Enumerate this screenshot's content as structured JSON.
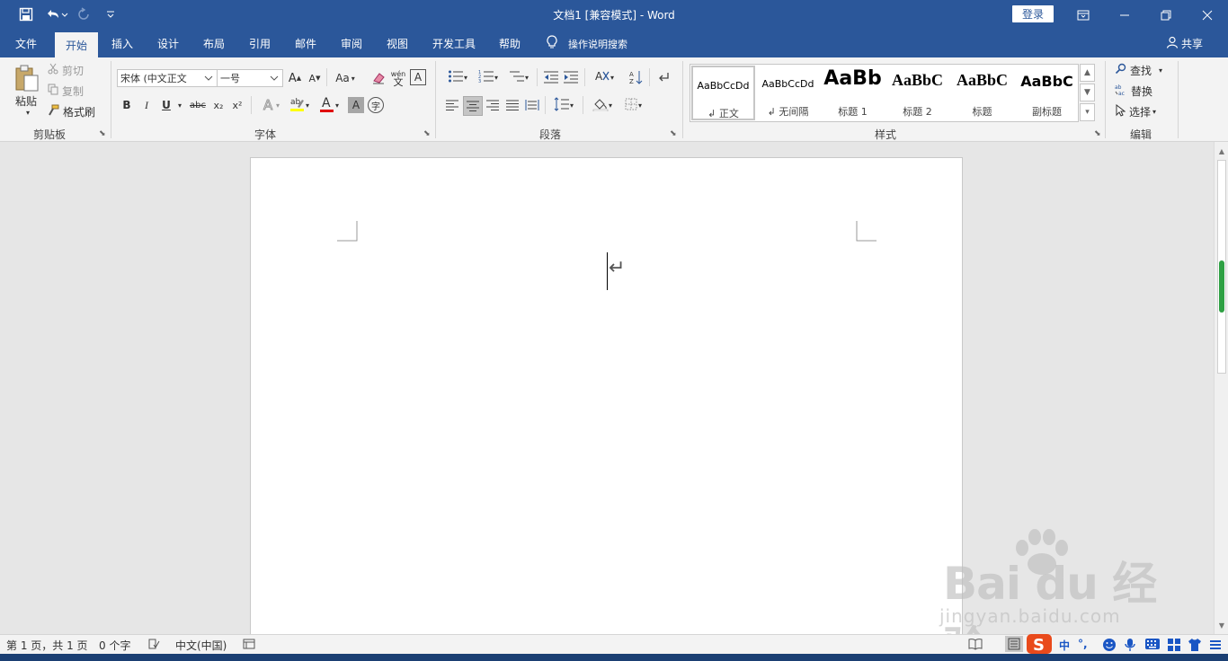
{
  "window": {
    "title": "文档1 [兼容模式]  -  Word",
    "login_label": "登录"
  },
  "icons": {
    "save": "save-icon",
    "undo": "undo-icon",
    "redo": "redo-icon",
    "customize": "customize-quick-access-icon",
    "ribbon_display": "ribbon-display-options-icon",
    "minimize": "minimize-icon",
    "restore": "restore-icon",
    "close": "close-icon",
    "lightbulb": "lightbulb-icon",
    "share": "share-person-icon"
  },
  "tabs": [
    {
      "label": "文件"
    },
    {
      "label": "开始"
    },
    {
      "label": "插入"
    },
    {
      "label": "设计"
    },
    {
      "label": "布局"
    },
    {
      "label": "引用"
    },
    {
      "label": "邮件"
    },
    {
      "label": "审阅"
    },
    {
      "label": "视图"
    },
    {
      "label": "开发工具"
    },
    {
      "label": "帮助"
    }
  ],
  "tell_me": "操作说明搜索",
  "share_label": "共享",
  "ribbon": {
    "clipboard": {
      "label": "剪贴板",
      "paste": "粘贴",
      "cut": "剪切",
      "copy": "复制",
      "format_painter": "格式刷"
    },
    "font": {
      "label": "字体",
      "font_name": "宋体 (中文正文",
      "font_size": "一号",
      "bold": "B",
      "italic": "I",
      "underline": "U",
      "strike": "abc",
      "subscript": "x₂",
      "superscript": "x²",
      "grow": "A",
      "shrink": "A",
      "case": "Aa",
      "phonetic": "wén",
      "phonetic_sub": "文",
      "char_border": "A",
      "font_color_glyph": "A",
      "shading_glyph": "A",
      "enclose": "字",
      "highlight_color": "#ffff00",
      "font_color": "#e00000"
    },
    "paragraph": {
      "label": "段落"
    },
    "styles": {
      "label": "样式",
      "items": [
        {
          "sample": "AaBbCcDd",
          "name": "↲ 正文"
        },
        {
          "sample": "AaBbCcDd",
          "name": "↲ 无间隔"
        },
        {
          "sample": "AaBb",
          "name": "标题 1"
        },
        {
          "sample": "AaBbC",
          "name": "标题 2"
        },
        {
          "sample": "AaBbC",
          "name": "标题"
        },
        {
          "sample": "AaBbC",
          "name": "副标题"
        }
      ]
    },
    "editing": {
      "label": "编辑",
      "find": "查找",
      "replace": "替换",
      "select": "选择"
    }
  },
  "document": {
    "paragraph_mark": "↵"
  },
  "statusbar": {
    "page": "第 1 页，共 1 页",
    "words": "0 个字",
    "language": "中文(中国)"
  },
  "ime": {
    "mode": "中",
    "punct": "°,"
  },
  "watermark": {
    "logo": "Bai du 经验",
    "url": "jingyan.baidu.com"
  },
  "colors": {
    "brand": "#2b579a",
    "ribbon_bg": "#f3f3f3",
    "doc_bg": "#e6e6e6"
  }
}
